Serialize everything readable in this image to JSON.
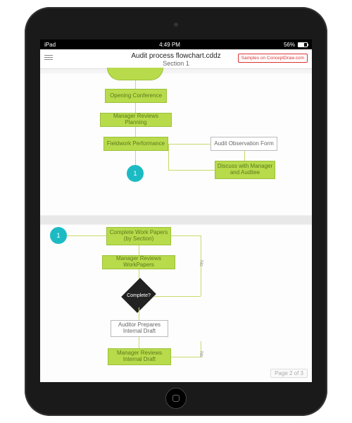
{
  "statusbar": {
    "carrier": "iPad",
    "time": "4:49 PM",
    "battery_pct": "56%"
  },
  "header": {
    "doc_title": "Audit process flowchart.cddz",
    "section": "Section 1",
    "samples_label": "Samples on ConceptDraw.com"
  },
  "footer": {
    "page_indicator": "Page 2 of 3"
  },
  "flow": {
    "page1": {
      "opening": "Opening Conference",
      "mgr_plan": "Manager Reviews Planning",
      "fieldwork": "Fieldwork Performance",
      "obs_form": "Audit Observation Form",
      "discuss": "Discuss with Manager and Auditee",
      "connector": "1"
    },
    "page2": {
      "connector": "1",
      "complete_wp": "Complete Work Papers (by Section)",
      "mgr_review_wp": "Manager Reviews WorkPapers",
      "decision": "Complete?",
      "no_label": "No",
      "auditor_draft": "Auditor Prepares Internal Draft",
      "mgr_review_draft": "Manager Reviews Internal Draft"
    }
  }
}
